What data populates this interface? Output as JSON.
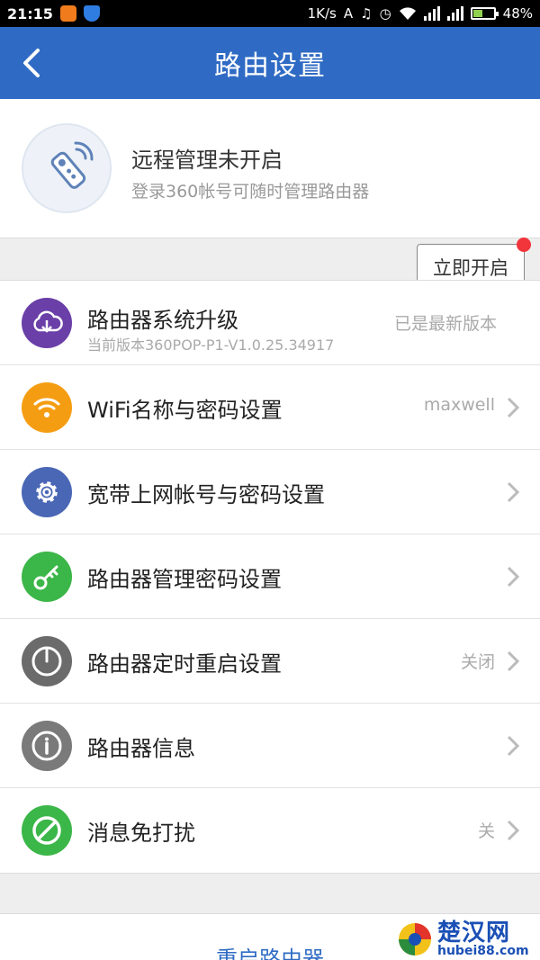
{
  "status_bar": {
    "time": "21:15",
    "network_speed": "1K/s",
    "battery_text": "48%",
    "battery_level": 0.48
  },
  "header": {
    "title": "路由设置"
  },
  "remote": {
    "title": "远程管理未开启",
    "subtitle": "登录360帐号可随时管理路由器",
    "button": "立即开启"
  },
  "settings": [
    {
      "label": "路由器系统升级",
      "sub": "当前版本360POP-P1-V1.0.25.34917",
      "value": "已是最新版本",
      "icon": "cloud-download-icon",
      "color": "#6a3fa8",
      "chevron": false
    },
    {
      "label": "WiFi名称与密码设置",
      "value": "maxwell",
      "icon": "wifi-icon",
      "color": "#f59d12",
      "chevron": true
    },
    {
      "label": "宽带上网帐号与密码设置",
      "value": "",
      "icon": "gear-icon",
      "color": "#4a67b6",
      "chevron": true
    },
    {
      "label": "路由器管理密码设置",
      "value": "",
      "icon": "key-icon",
      "color": "#3bb648",
      "chevron": true
    },
    {
      "label": "路由器定时重启设置",
      "value": "关闭",
      "icon": "timer-icon",
      "color": "#6b6b6b",
      "chevron": true
    },
    {
      "label": "路由器信息",
      "value": "",
      "icon": "info-icon",
      "color": "#7a7a7a",
      "chevron": true
    },
    {
      "label": "消息免打扰",
      "value": "关",
      "icon": "no-disturb-icon",
      "color": "#3bb648",
      "chevron": true
    }
  ],
  "footer": {
    "restart": "重启路由器"
  },
  "watermark": {
    "name": "楚汉网",
    "domain": "hubei88.com"
  }
}
